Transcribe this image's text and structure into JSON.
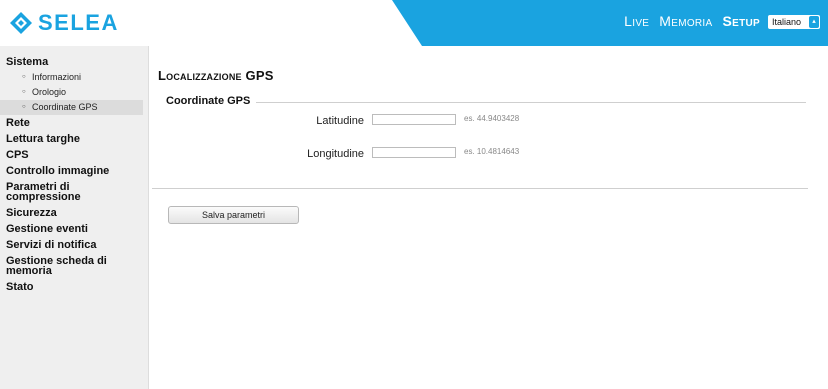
{
  "header": {
    "logo_text": "SELEA",
    "brand_color": "#1aa3e0",
    "nav": [
      {
        "label": "Live",
        "active": false
      },
      {
        "label": "Memoria",
        "active": false
      },
      {
        "label": "Setup",
        "active": true
      }
    ],
    "language_select": {
      "value": "Italiano",
      "icon": "chevron-updown-icon"
    }
  },
  "sidebar": {
    "sections": [
      {
        "label": "Sistema",
        "items": [
          "Informazioni",
          "Orologio",
          "Coordinate GPS"
        ],
        "active_item": "Coordinate GPS"
      },
      {
        "label": "Rete"
      },
      {
        "label": "Lettura targhe"
      },
      {
        "label": "CPS"
      },
      {
        "label": "Controllo immagine"
      },
      {
        "label": "Parametri di compressione"
      },
      {
        "label": "Sicurezza"
      },
      {
        "label": "Gestione eventi"
      },
      {
        "label": "Servizi di notifica"
      },
      {
        "label": "Gestione scheda di memoria"
      },
      {
        "label": "Stato"
      }
    ]
  },
  "main": {
    "title": "Localizzazione GPS",
    "fieldset_legend": "Coordinate GPS",
    "fields": [
      {
        "label": "Latitudine",
        "value": "",
        "hint": "es. 44.9403428"
      },
      {
        "label": "Longitudine",
        "value": "",
        "hint": "es. 10.4814643"
      }
    ],
    "save_button": "Salva parametri"
  }
}
